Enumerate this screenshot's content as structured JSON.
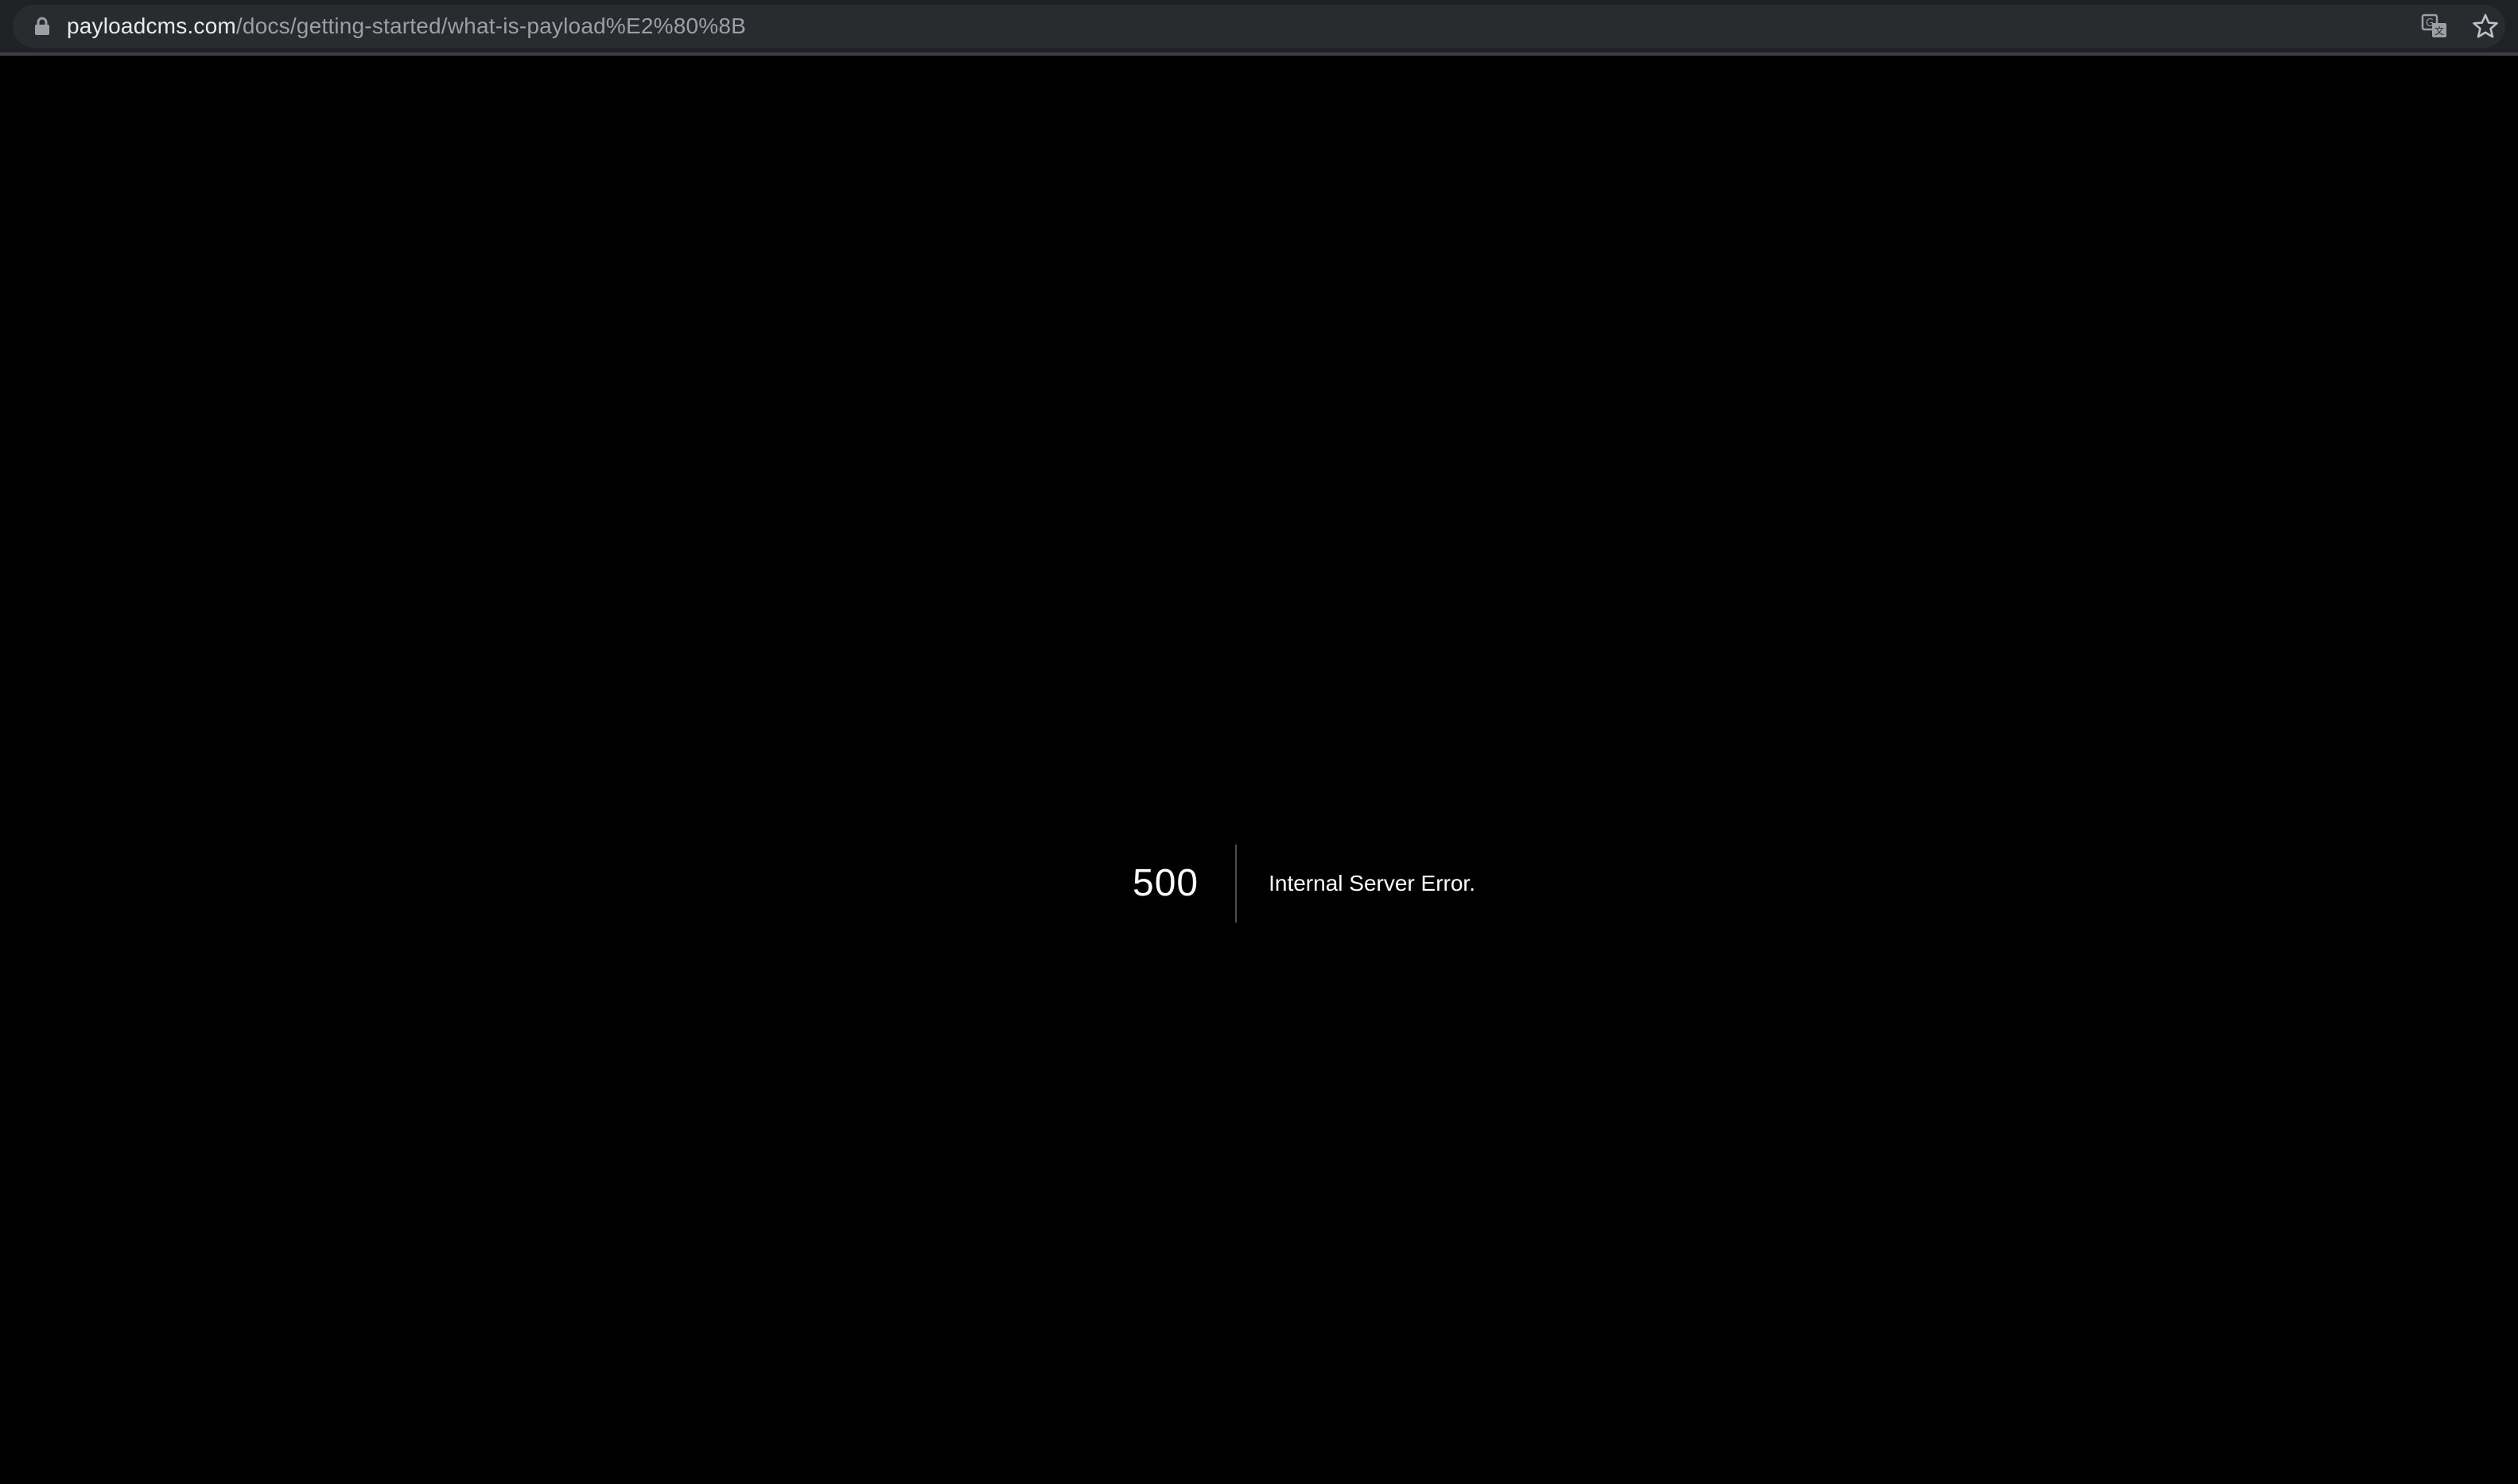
{
  "browser": {
    "url_host": "payloadcms.com",
    "url_path": "/docs/getting-started/what-is-payload%E2%80%8B",
    "icons": {
      "lock": "lock-icon",
      "translate": "translate-icon",
      "bookmark": "star-icon"
    }
  },
  "error": {
    "code": "500",
    "message": "Internal Server Error."
  },
  "colors": {
    "page_background": "#000000",
    "toolbar_background": "#202124",
    "address_bar_background": "#2a2b2e",
    "url_host_text": "#e8eaed",
    "url_path_text": "#9aa0a6",
    "error_text": "#ffffff"
  }
}
